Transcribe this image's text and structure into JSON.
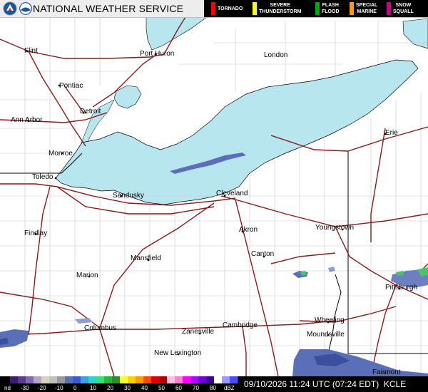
{
  "header": {
    "title": "NATIONAL WEATHER SERVICE"
  },
  "warnings": [
    {
      "label_lines": [
        "TORNADO"
      ],
      "color": "#ff0000"
    },
    {
      "label_lines": [
        "SEVERE",
        "THUNDERSTORM"
      ],
      "color": "#ffff00"
    },
    {
      "label_lines": [
        "FLASH",
        "FLOOD"
      ],
      "color": "#00aa00"
    },
    {
      "label_lines": [
        "SPECIAL",
        "MARINE"
      ],
      "color": "#ff9900"
    },
    {
      "label_lines": [
        "SNOW",
        "SQUALL"
      ],
      "color": "#cc0088"
    }
  ],
  "cities": [
    "Flint",
    "Port Huron",
    "London",
    "Pontiac",
    "Detroit",
    "Ann Arbor",
    "Monroe",
    "Toledo",
    "Sandusky",
    "Cleveland",
    "Erie",
    "Findlay",
    "Akron",
    "Youngstown",
    "Canton",
    "Mansfield",
    "Marion",
    "Pittsburgh",
    "Wheeling",
    "Columbus",
    "Cambridge",
    "Zanesville",
    "Moundsville",
    "New Lexington",
    "Fairmont"
  ],
  "footer": {
    "timestamp": "09/10/2026 11:24 UTC (07:24 EDT)",
    "station": "KCLE",
    "scale_labels": [
      "nd",
      "-30",
      "-20",
      "-10",
      "0",
      "10",
      "20",
      "30",
      "40",
      "50",
      "60",
      "70",
      "80",
      "dBZ"
    ]
  },
  "colors": {
    "water": "#b8e6ee",
    "county_lines": "#c8c8c8",
    "state_lines": "#000000",
    "highways": "#8b1a1a",
    "radar_blue": "#5a6fb8"
  }
}
